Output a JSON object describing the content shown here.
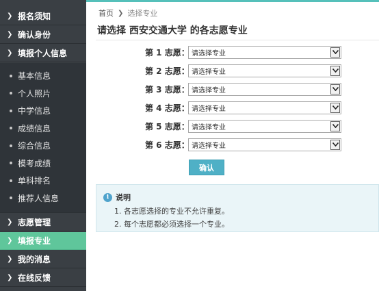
{
  "sidebar": {
    "top_items": [
      {
        "label": "报名须知"
      },
      {
        "label": "确认身份"
      },
      {
        "label": "填报个人信息"
      }
    ],
    "sub_items": [
      {
        "label": "基本信息"
      },
      {
        "label": "个人照片"
      },
      {
        "label": "中学信息"
      },
      {
        "label": "成绩信息"
      },
      {
        "label": "综合信息"
      },
      {
        "label": "模考成绩"
      },
      {
        "label": "单科排名"
      },
      {
        "label": "推荐人信息"
      }
    ],
    "bottom_items": [
      {
        "label": "志愿管理"
      },
      {
        "label": "填报专业"
      },
      {
        "label": "我的消息"
      },
      {
        "label": "在线反馈"
      }
    ],
    "active_item": "填报专业"
  },
  "breadcrumb": {
    "home": "首页",
    "current": "选择专业"
  },
  "page": {
    "title": "请选择 西安交通大学 的各志愿专业"
  },
  "form": {
    "choices": [
      {
        "label": "第 1 志愿：",
        "value": "请选择专业"
      },
      {
        "label": "第 2 志愿：",
        "value": "请选择专业"
      },
      {
        "label": "第 3 志愿：",
        "value": "请选择专业"
      },
      {
        "label": "第 4 志愿：",
        "value": "请选择专业"
      },
      {
        "label": "第 5 志愿：",
        "value": "请选择专业"
      },
      {
        "label": "第 6 志愿：",
        "value": "请选择专业"
      }
    ],
    "confirm_label": "确认"
  },
  "info": {
    "heading": "说明",
    "lines": [
      "1. 各志愿选择的专业不允许重复。",
      "2. 每个志愿都必须选择一个专业。"
    ]
  },
  "colors": {
    "sidebar_bg": "#3a3f44",
    "active_bg": "#5fc69b",
    "accent": "#4fb0c6",
    "info_bg": "#eaf5f8"
  }
}
